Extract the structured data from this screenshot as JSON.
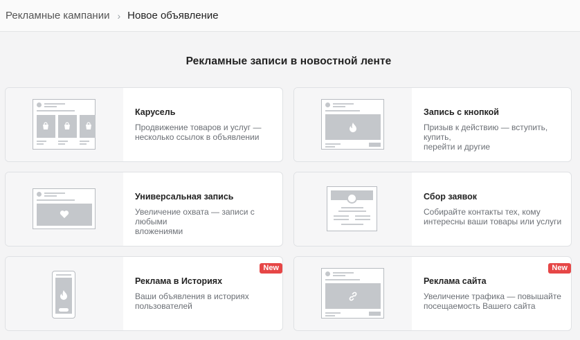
{
  "breadcrumb": {
    "parent": "Рекламные кампании",
    "separator": "›",
    "current": "Новое объявление"
  },
  "section_title": "Рекламные записи в новостной ленте",
  "cards": [
    {
      "title": "Карусель",
      "description": "Продвижение товаров и услуг —\nнесколько ссылок в объявлении",
      "preview_icon": "bag-icon"
    },
    {
      "title": "Запись с кнопкой",
      "description": "Призыв к действию — вступить, купить,\nперейти и другие",
      "preview_icon": "flame-icon"
    },
    {
      "title": "Универсальная запись",
      "description": "Увеличение охвата — записи с любыми\nвложениями",
      "preview_icon": "heart-icon"
    },
    {
      "title": "Сбор заявок",
      "description": "Собирайте контакты тех, кому\nинтересны ваши товары или услуги",
      "preview_icon": "form-icon"
    },
    {
      "title": "Реклама в Историях",
      "description": "Ваши объявления в историях\nпользователей",
      "preview_icon": "flame-icon",
      "badge": "New"
    },
    {
      "title": "Реклама сайта",
      "description": "Увеличение трафика — повышайте\nпосещаемость Вашего сайта",
      "preview_icon": "link-icon",
      "badge": "New"
    }
  ],
  "colors": {
    "badge": "#e64646",
    "mock_fill": "#c4c7cb",
    "background": "#f4f4f5"
  }
}
